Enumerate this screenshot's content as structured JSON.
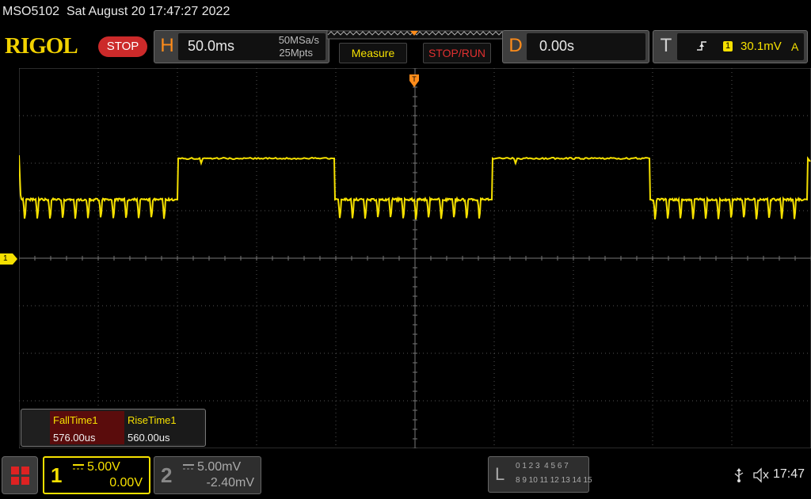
{
  "titlebar": {
    "model": "MSO5102",
    "datetime": "Sat August 20 17:47:27 2022"
  },
  "brand": {
    "logo": "RIGOL",
    "status": "STOP"
  },
  "horizontal": {
    "letter": "H",
    "timebase": "50.0ms",
    "sample_rate": "50MSa/s",
    "memory": "25Mpts"
  },
  "menu": {
    "measure": "Measure",
    "stoprun": "STOP/RUN"
  },
  "delay": {
    "letter": "D",
    "value": "0.00s"
  },
  "trigger": {
    "letter": "T",
    "source": "1",
    "level": "30.1mV",
    "mode": "A"
  },
  "channel_marker": "1",
  "measurements": [
    {
      "label": "FallTime1",
      "value": "576.00us"
    },
    {
      "label": "RiseTime1",
      "value": "560.00us"
    }
  ],
  "ch1": {
    "number": "1",
    "scale": "5.00V",
    "offset": "0.00V"
  },
  "ch2": {
    "number": "2",
    "scale": "5.00mV",
    "offset": "-2.40mV"
  },
  "logic": {
    "letter": "L",
    "row1": "0 1 2 3  4 5 6 7",
    "row2": "8 9 10 11 12 13 14 15"
  },
  "clock": "17:47",
  "colors": {
    "ch1": "#f5e000",
    "orange": "#ff8c1a",
    "red": "#e03030",
    "grid": "#555555"
  }
}
